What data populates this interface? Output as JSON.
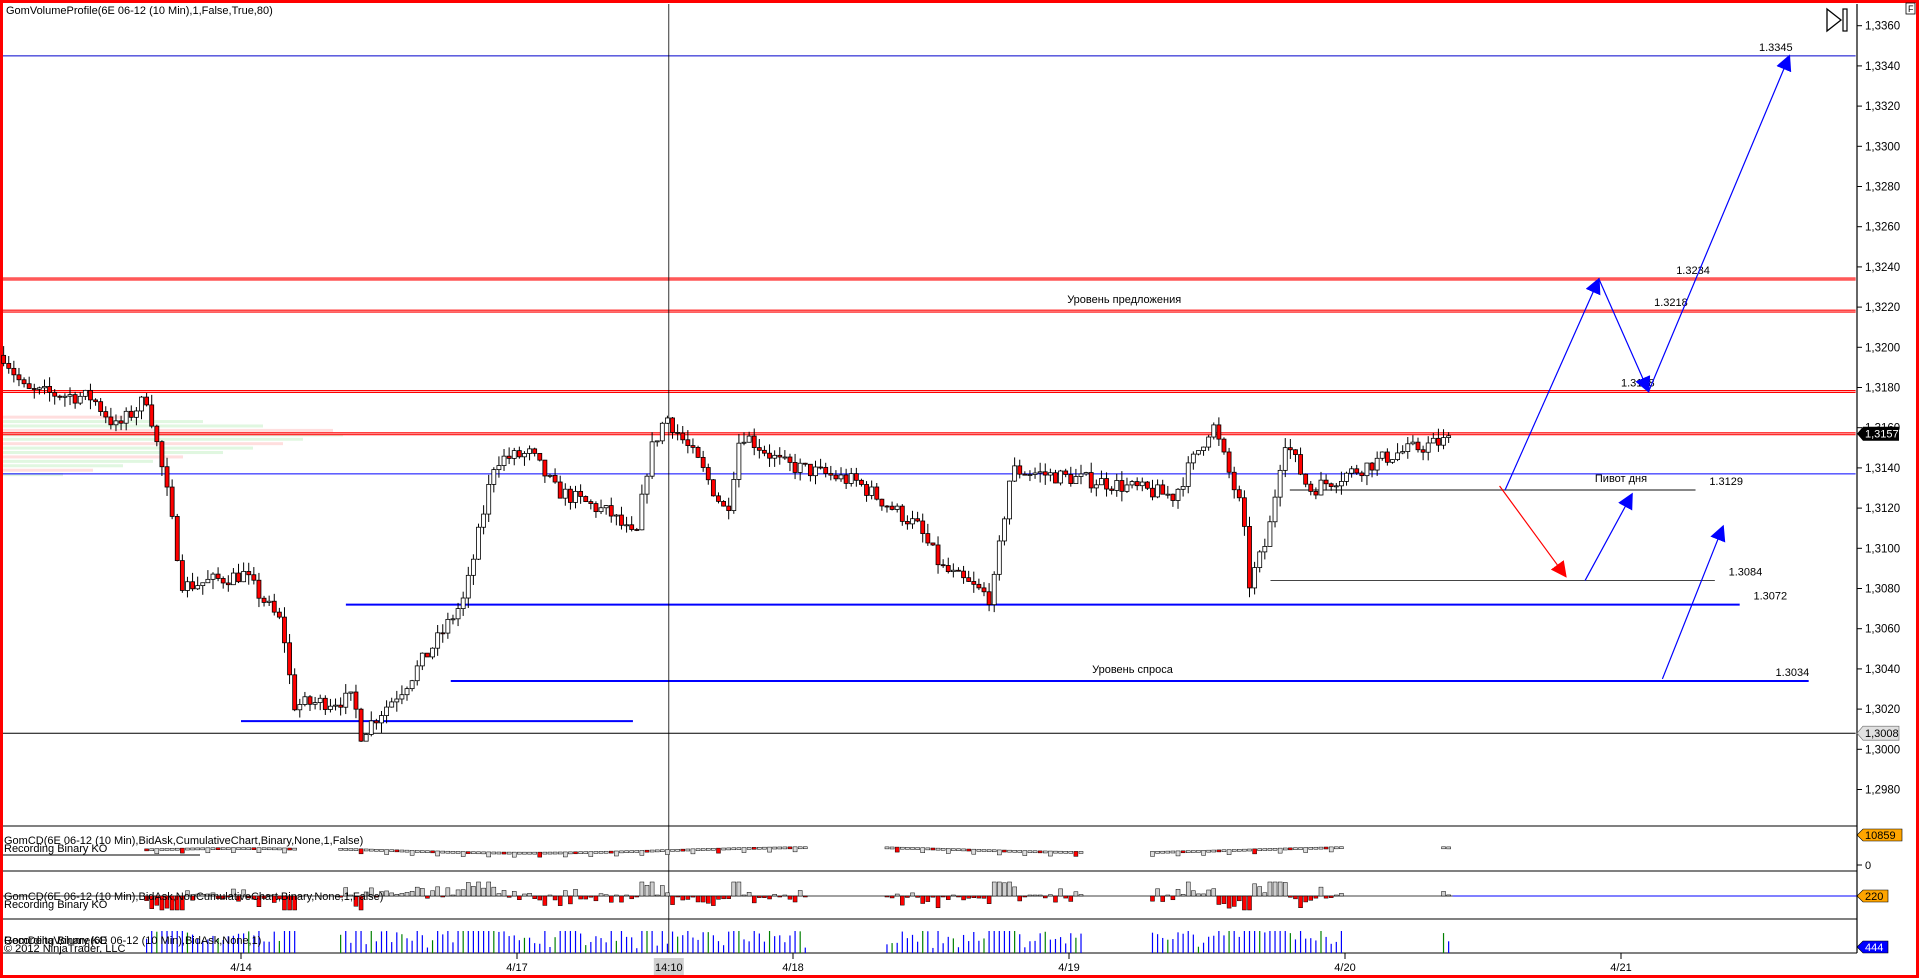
{
  "window": {
    "indicator_title": "GomVolumeProfile(6E 06-12 (10 Min),1,False,True,80)",
    "f_button": "F",
    "scroll_end_icon": "play-to-end-icon"
  },
  "chart_data": {
    "type": "candlestick",
    "instrument": "6E 06-12 (10 Min)",
    "ylim": [
      1.2965,
      1.3372
    ],
    "y_ticks": [
      "1,3360",
      "1,3340",
      "1,3320",
      "1,3300",
      "1,3280",
      "1,3260",
      "1,3240",
      "1,3220",
      "1,3200",
      "1,3180",
      "1,3160",
      "1,3140",
      "1,3120",
      "1,3100",
      "1,3080",
      "1,3060",
      "1,3040",
      "1,3020",
      "1,3000",
      "1,2980"
    ],
    "y_tick_values": [
      1.336,
      1.334,
      1.332,
      1.33,
      1.328,
      1.326,
      1.324,
      1.322,
      1.32,
      1.318,
      1.316,
      1.314,
      1.312,
      1.31,
      1.308,
      1.306,
      1.304,
      1.302,
      1.3,
      1.298
    ],
    "x_ticks": [
      {
        "label": "4/14",
        "t": 0
      },
      {
        "label": "4/17",
        "t": 1
      },
      {
        "label": "4/18",
        "t": 2
      },
      {
        "label": "4/19",
        "t": 3
      },
      {
        "label": "4/20",
        "t": 4
      },
      {
        "label": "4/21",
        "t": 5
      }
    ],
    "crosshair": {
      "label": "14:10",
      "t": 1.55
    },
    "current_price": {
      "label": "1,3157",
      "value": 1.3157
    },
    "marker_price": {
      "label": "1,3008",
      "value": 1.3008
    },
    "price_path": [
      [
        -0.86,
        1.3196
      ],
      [
        -0.78,
        1.3178
      ],
      [
        -0.54,
        1.3175
      ],
      [
        -0.45,
        1.316
      ],
      [
        -0.34,
        1.3175
      ],
      [
        -0.27,
        1.3129
      ],
      [
        -0.21,
        1.3081
      ],
      [
        0.01,
        1.3087
      ],
      [
        0.15,
        1.3062
      ],
      [
        0.19,
        1.3022
      ],
      [
        0.41,
        1.3025
      ],
      [
        0.43,
        1.3007
      ],
      [
        0.59,
        1.3031
      ],
      [
        0.72,
        1.3056
      ],
      [
        0.81,
        1.3075
      ],
      [
        0.92,
        1.3144
      ],
      [
        1.05,
        1.3147
      ],
      [
        1.14,
        1.3129
      ],
      [
        1.34,
        1.3117
      ],
      [
        1.43,
        1.3104
      ],
      [
        1.48,
        1.3147
      ],
      [
        1.54,
        1.3166
      ],
      [
        1.66,
        1.3142
      ],
      [
        1.76,
        1.3117
      ],
      [
        1.81,
        1.3158
      ],
      [
        1.96,
        1.3142
      ],
      [
        2.23,
        1.3133
      ],
      [
        2.45,
        1.3111
      ],
      [
        2.54,
        1.309
      ],
      [
        2.72,
        1.3075
      ],
      [
        2.79,
        1.3139
      ],
      [
        3.12,
        1.3133
      ],
      [
        3.38,
        1.3126
      ],
      [
        3.52,
        1.3162
      ],
      [
        3.63,
        1.3117
      ],
      [
        3.65,
        1.3081
      ],
      [
        3.72,
        1.3105
      ],
      [
        3.78,
        1.3155
      ],
      [
        3.87,
        1.3129
      ],
      [
        4.18,
        1.3147
      ],
      [
        4.38,
        1.3154
      ],
      [
        4.39,
        1.3157
      ]
    ],
    "levels": [
      {
        "price": 1.3345,
        "color": "#0000cc",
        "style": "thin",
        "from": -0.87,
        "to": 5.85,
        "label": "1.3345",
        "label_t": 5.5
      },
      {
        "price": 1.3234,
        "color": "#ff0000",
        "style": "double",
        "from": -0.87,
        "to": 5.85,
        "label": "1.3234",
        "label_t": 5.2
      },
      {
        "price": 1.3218,
        "color": "#ff0000",
        "style": "double",
        "from": -0.87,
        "to": 5.85,
        "label": "1.3218",
        "label_t": 5.12,
        "caption": "Уровень предложения",
        "caption_t": 3.2
      },
      {
        "price": 1.3178,
        "color": "#ff0000",
        "style": "double",
        "from": -0.87,
        "to": 5.85,
        "label": "1.3178",
        "label_t": 5.0
      },
      {
        "price": 1.3157,
        "color": "#ff0000",
        "style": "double",
        "from": -0.87,
        "to": 5.85
      },
      {
        "price": 1.3137,
        "color": "#0000ff",
        "style": "thin",
        "from": -0.87,
        "to": 5.85
      },
      {
        "price": 1.3129,
        "color": "#888888",
        "style": "medium",
        "from": 3.8,
        "to": 5.27,
        "label": "1.3129",
        "label_t": 5.32,
        "caption": "Пивот дня",
        "caption_t": 5.0
      },
      {
        "price": 1.3084,
        "color": "#444444",
        "style": "thin",
        "from": 3.73,
        "to": 5.34,
        "label": "1.3084",
        "label_t": 5.39
      },
      {
        "price": 1.3072,
        "color": "#0000ff",
        "style": "thick",
        "from": 0.38,
        "to": 5.43,
        "label": "1.3072",
        "label_t": 5.48
      },
      {
        "price": 1.3034,
        "color": "#0000ff",
        "style": "thick",
        "from": 0.76,
        "to": 5.68,
        "label": "1.3034",
        "label_t": 5.56,
        "caption": "Уровень спроса",
        "caption_t": 3.23
      },
      {
        "price": 1.3014,
        "color": "#0000ff",
        "style": "thick",
        "from": 0.0,
        "to": 1.42
      },
      {
        "price": 1.3008,
        "color": "#000000",
        "style": "thin",
        "from": -0.87,
        "to": 5.85
      }
    ],
    "arrows": [
      {
        "from": [
          4.58,
          1.3129
        ],
        "to": [
          4.92,
          1.3234
        ],
        "color": "#0000ff"
      },
      {
        "from": [
          4.92,
          1.3234
        ],
        "to": [
          5.1,
          1.3178
        ],
        "color": "#0000ff"
      },
      {
        "from": [
          5.1,
          1.3178
        ],
        "to": [
          5.61,
          1.3345
        ],
        "color": "#0000ff"
      },
      {
        "from": [
          4.56,
          1.3131
        ],
        "to": [
          4.8,
          1.3086
        ],
        "color": "#ff0000"
      },
      {
        "from": [
          4.87,
          1.3084
        ],
        "to": [
          5.04,
          1.3127
        ],
        "color": "#0000ff"
      },
      {
        "from": [
          5.15,
          1.3035
        ],
        "to": [
          5.37,
          1.3111
        ],
        "color": "#0000ff"
      }
    ],
    "indicator_gaps": [
      [
        -0.9,
        -0.36
      ],
      [
        0.21,
        0.35
      ],
      [
        2.05,
        2.34
      ],
      [
        3.05,
        3.3
      ],
      [
        4.0,
        4.34
      ]
    ]
  },
  "panels": [
    {
      "title": "GomCD(6E 06-12 (10 Min),BidAsk,CumulativeChart,Binary,None,1,False)",
      "subtitle": "Recording Binary KO",
      "tag": "10859",
      "tag_color": "#ffa500",
      "zero_label": "0"
    },
    {
      "title": "GomCD(6E 06-12 (10 Min),BidAsk,NonCumulativeChart,Binary,None,1,False)",
      "subtitle": "Recording Binary KO",
      "tag": "220",
      "tag_color": "#ffa500"
    },
    {
      "title": "GomDeltaVolume(6E 06-12 (10 Min),BidAsk,None,1)",
      "subtitle": "Recording Binary KO",
      "copyright": "© 2012 NinjaTrader, LLC",
      "tag": "444",
      "tag_color": "#0000ff"
    }
  ]
}
